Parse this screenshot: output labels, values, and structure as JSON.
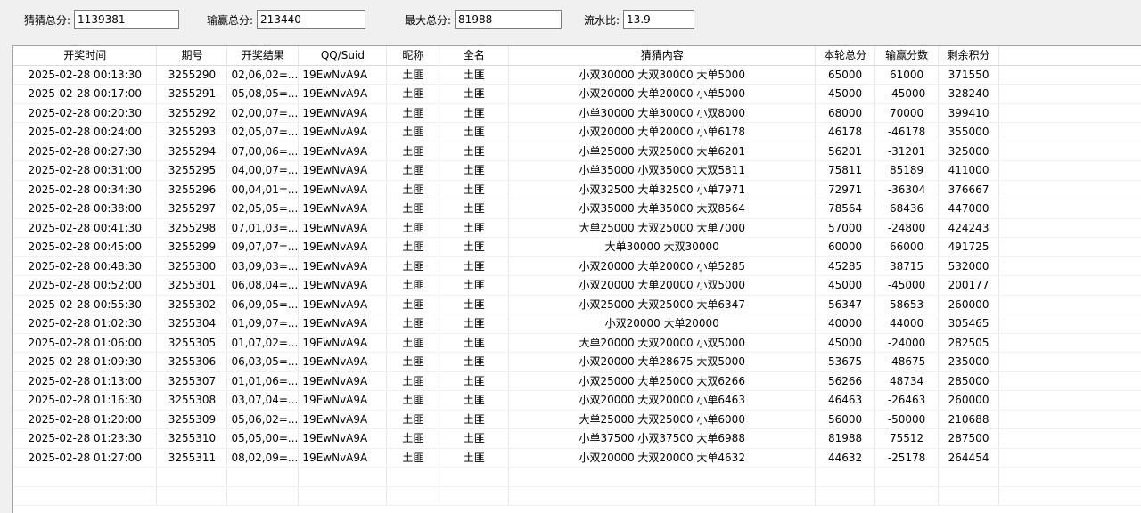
{
  "summary": {
    "guess_total_label": "猜猜总分:",
    "guess_total_value": "1139381",
    "win_loss_total_label": "输赢总分:",
    "win_loss_total_value": "213440",
    "max_total_label": "最大总分:",
    "max_total_value": "81988",
    "flow_ratio_label": "流水比:",
    "flow_ratio_value": "13.9"
  },
  "table": {
    "columns": [
      "开奖时间",
      "期号",
      "开奖结果",
      "QQ/Suid",
      "昵称",
      "全名",
      "猜猜内容",
      "本轮总分",
      "输赢分数",
      "剩余积分"
    ],
    "rows": [
      [
        "2025-02-28 00:13:30",
        "3255290",
        "02,06,02=...",
        "19EwNvA9A",
        "土匪",
        "土匪",
        "小双30000 大双30000 大单5000",
        "65000",
        "61000",
        "371550"
      ],
      [
        "2025-02-28 00:17:00",
        "3255291",
        "05,08,05=...",
        "19EwNvA9A",
        "土匪",
        "土匪",
        "小双20000 大单20000 小单5000",
        "45000",
        "-45000",
        "328240"
      ],
      [
        "2025-02-28 00:20:30",
        "3255292",
        "02,00,07=...",
        "19EwNvA9A",
        "土匪",
        "土匪",
        "小单30000 大单30000 小双8000",
        "68000",
        "70000",
        "399410"
      ],
      [
        "2025-02-28 00:24:00",
        "3255293",
        "02,05,07=...",
        "19EwNvA9A",
        "土匪",
        "土匪",
        "小双20000 大单20000 小单6178",
        "46178",
        "-46178",
        "355000"
      ],
      [
        "2025-02-28 00:27:30",
        "3255294",
        "07,00,06=...",
        "19EwNvA9A",
        "土匪",
        "土匪",
        "小单25000 大双25000 大单6201",
        "56201",
        "-31201",
        "325000"
      ],
      [
        "2025-02-28 00:31:00",
        "3255295",
        "04,00,07=...",
        "19EwNvA9A",
        "土匪",
        "土匪",
        "小单35000 小双35000 大双5811",
        "75811",
        "85189",
        "411000"
      ],
      [
        "2025-02-28 00:34:30",
        "3255296",
        "00,04,01=...",
        "19EwNvA9A",
        "土匪",
        "土匪",
        "小双32500 大单32500 小单7971",
        "72971",
        "-36304",
        "376667"
      ],
      [
        "2025-02-28 00:38:00",
        "3255297",
        "02,05,05=...",
        "19EwNvA9A",
        "土匪",
        "土匪",
        "小双35000 大单35000 大双8564",
        "78564",
        "68436",
        "447000"
      ],
      [
        "2025-02-28 00:41:30",
        "3255298",
        "07,01,03=...",
        "19EwNvA9A",
        "土匪",
        "土匪",
        "大单25000 大双25000 大单7000",
        "57000",
        "-24800",
        "424243"
      ],
      [
        "2025-02-28 00:45:00",
        "3255299",
        "09,07,07=...",
        "19EwNvA9A",
        "土匪",
        "土匪",
        "大单30000 大双30000",
        "60000",
        "66000",
        "491725"
      ],
      [
        "2025-02-28 00:48:30",
        "3255300",
        "03,09,03=...",
        "19EwNvA9A",
        "土匪",
        "土匪",
        "小双20000 大单20000 小单5285",
        "45285",
        "38715",
        "532000"
      ],
      [
        "2025-02-28 00:52:00",
        "3255301",
        "06,08,04=...",
        "19EwNvA9A",
        "土匪",
        "土匪",
        "小双20000 大单20000 小双5000",
        "45000",
        "-45000",
        "200177"
      ],
      [
        "2025-02-28 00:55:30",
        "3255302",
        "06,09,05=...",
        "19EwNvA9A",
        "土匪",
        "土匪",
        "小双25000 大双25000 大单6347",
        "56347",
        "58653",
        "260000"
      ],
      [
        "2025-02-28 01:02:30",
        "3255304",
        "01,09,07=...",
        "19EwNvA9A",
        "土匪",
        "土匪",
        "小双20000 大单20000",
        "40000",
        "44000",
        "305465"
      ],
      [
        "2025-02-28 01:06:00",
        "3255305",
        "01,07,02=...",
        "19EwNvA9A",
        "土匪",
        "土匪",
        "大单20000 大双20000 小双5000",
        "45000",
        "-24000",
        "282505"
      ],
      [
        "2025-02-28 01:09:30",
        "3255306",
        "06,03,05=...",
        "19EwNvA9A",
        "土匪",
        "土匪",
        "小双20000 大单28675 大双5000",
        "53675",
        "-48675",
        "235000"
      ],
      [
        "2025-02-28 01:13:00",
        "3255307",
        "01,01,06=...",
        "19EwNvA9A",
        "土匪",
        "土匪",
        "小双25000 大单25000 大双6266",
        "56266",
        "48734",
        "285000"
      ],
      [
        "2025-02-28 01:16:30",
        "3255308",
        "03,07,04=...",
        "19EwNvA9A",
        "土匪",
        "土匪",
        "小双20000 大双20000 小单6463",
        "46463",
        "-26463",
        "260000"
      ],
      [
        "2025-02-28 01:20:00",
        "3255309",
        "05,06,02=...",
        "19EwNvA9A",
        "土匪",
        "土匪",
        "大单25000 大双25000 小单6000",
        "56000",
        "-50000",
        "210688"
      ],
      [
        "2025-02-28 01:23:30",
        "3255310",
        "05,05,00=...",
        "19EwNvA9A",
        "土匪",
        "土匪",
        "小单37500 小双37500 大单6988",
        "81988",
        "75512",
        "287500"
      ],
      [
        "2025-02-28 01:27:00",
        "3255311",
        "08,02,09=...",
        "19EwNvA9A",
        "土匪",
        "土匪",
        "小双20000 大双20000 大单4632",
        "44632",
        "-25178",
        "264454"
      ]
    ]
  }
}
